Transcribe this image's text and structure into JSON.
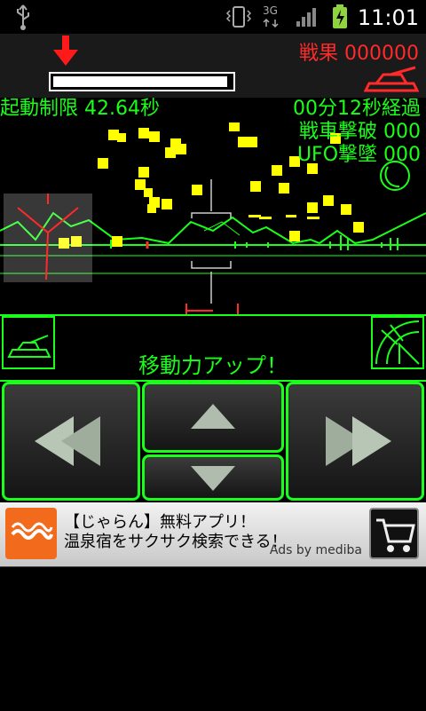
{
  "status_bar": {
    "time": "11:01",
    "icons": [
      "usb-icon",
      "vibrate-icon",
      "3g-icon",
      "signal-icon",
      "battery-icon"
    ]
  },
  "header": {
    "score_label": "戦果 000000",
    "hp_fraction": 0.98
  },
  "hud": {
    "time_limit": "起動制限 42.64秒",
    "elapsed": "00分12秒経過",
    "tanks_destroyed": "戦車撃破 000",
    "ufo_destroyed": "UFO撃墜 000"
  },
  "message": "移動力アップ！",
  "colors": {
    "hud_green": "#1aff1a",
    "enemy_red": "#ff2a2a",
    "debris_yellow": "#ffff00",
    "ad_orange": "#f26b1d"
  },
  "controls": {
    "rotate_left_icon": "double-left-arrow-icon",
    "rotate_right_icon": "double-right-arrow-icon",
    "forward_icon": "up-triangle-icon",
    "backward_icon": "down-triangle-icon"
  },
  "ad": {
    "line1": "【じゃらん】無料アプリ！",
    "line2": "温泉宿をサクサク検索できる！",
    "by": "Ads by mediba"
  }
}
